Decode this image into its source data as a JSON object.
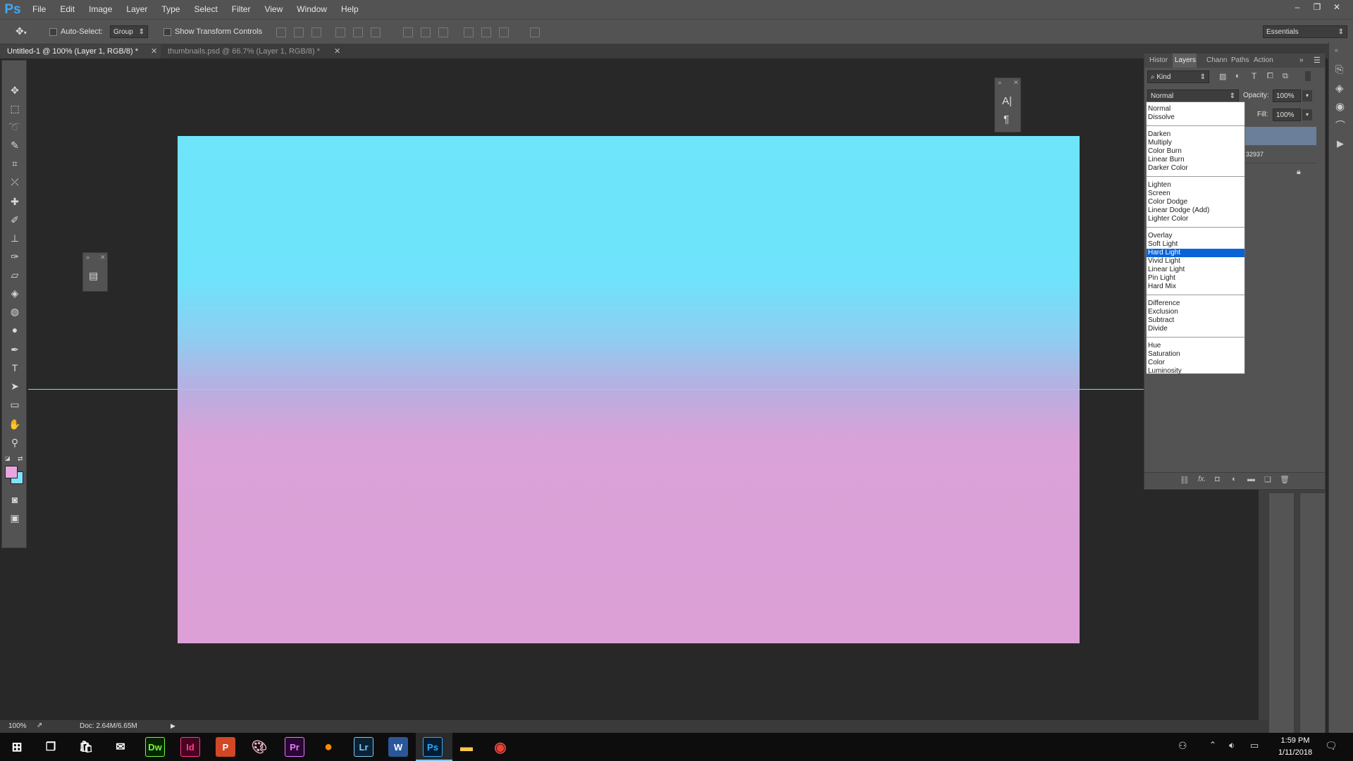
{
  "app": {
    "logo": "Ps"
  },
  "menu": [
    "File",
    "Edit",
    "Image",
    "Layer",
    "Type",
    "Select",
    "Filter",
    "View",
    "Window",
    "Help"
  ],
  "window_controls": {
    "minimize": "–",
    "restore": "❐",
    "close": "✕"
  },
  "options_bar": {
    "auto_select_label": "Auto-Select:",
    "auto_select_value": "Group",
    "transform_label": "Show Transform Controls",
    "workspace": "Essentials"
  },
  "doc_tabs": [
    {
      "label": "Untitled-1 @ 100% (Layer 1, RGB/8) *"
    },
    {
      "label": "thumbnails.psd @ 66.7% (Layer 1, RGB/8) *"
    }
  ],
  "layers_panel": {
    "tabs": [
      "Histor",
      "Layers",
      "Chann",
      "Paths",
      "Action"
    ],
    "kind_filter": "Kind",
    "blend_mode": "Normal",
    "opacity_label": "Opacity:",
    "opacity_value": "100%",
    "fill_label": "Fill:",
    "fill_value": "100%",
    "layer_name_fragment": "32937"
  },
  "blend_modes": {
    "selected": "Hard Light",
    "groups": [
      [
        "Normal",
        "Dissolve"
      ],
      [
        "Darken",
        "Multiply",
        "Color Burn",
        "Linear Burn",
        "Darker Color"
      ],
      [
        "Lighten",
        "Screen",
        "Color Dodge",
        "Linear Dodge (Add)",
        "Lighter Color"
      ],
      [
        "Overlay",
        "Soft Light",
        "Hard Light",
        "Vivid Light",
        "Linear Light",
        "Pin Light",
        "Hard Mix"
      ],
      [
        "Difference",
        "Exclusion",
        "Subtract",
        "Divide"
      ],
      [
        "Hue",
        "Saturation",
        "Color",
        "Luminosity"
      ]
    ]
  },
  "colors": {
    "foreground": "#e8a6e0",
    "background": "#7fe3ff",
    "gradient_top": "#6ee5fb",
    "gradient_bottom": "#dc9fd6",
    "guide": "#5fe6ff"
  },
  "status": {
    "zoom": "100%",
    "doc": "Doc: 2.64M/6.65M"
  },
  "taskbar": {
    "apps": [
      "Dw",
      "Id",
      "P",
      "Pr",
      "Lr",
      "W",
      "Ps"
    ],
    "time": "1:59 PM",
    "date": "1/11/2018"
  }
}
